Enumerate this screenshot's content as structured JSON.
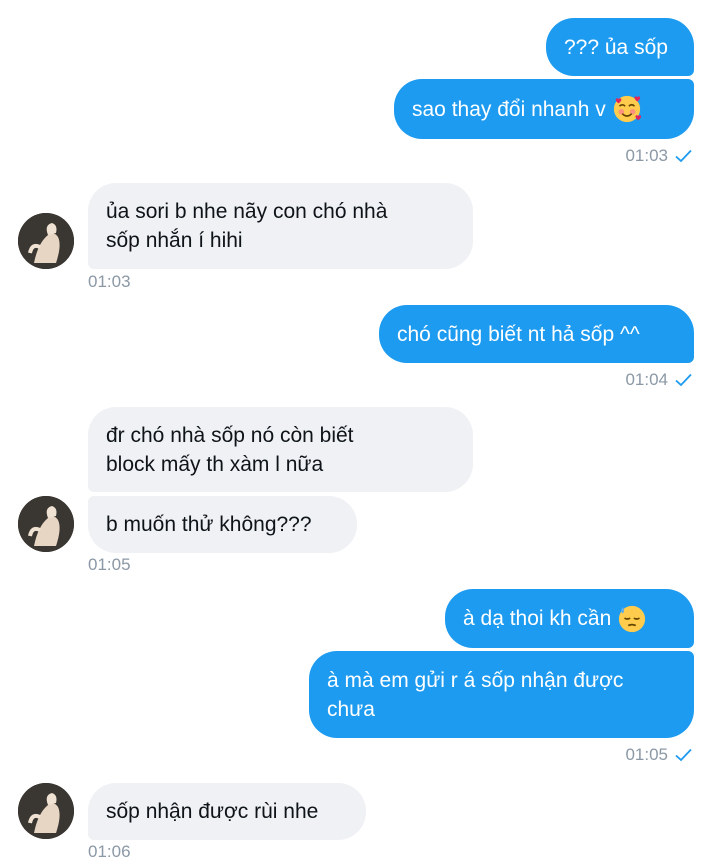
{
  "colors": {
    "outgoing_bubble": "#1d9bf0",
    "incoming_bubble": "#eff1f4",
    "timestamp": "#8b98a5",
    "read_check": "#1d9bf0"
  },
  "messages": {
    "m1": {
      "text": "??? ủa sốp"
    },
    "m2": {
      "text": "sao thay đổi nhanh v",
      "emoji": "smiling-face-with-hearts-icon"
    },
    "t1": {
      "time": "01:03"
    },
    "m3": {
      "line1": "ủa sori b nhe nãy con chó nhà",
      "line2": "sốp nhắn í hihi"
    },
    "t2": {
      "time": "01:03"
    },
    "m4": {
      "text": "chó cũng biết nt hả sốp ^^"
    },
    "t3": {
      "time": "01:04"
    },
    "m5": {
      "line1": "đr chó nhà sốp nó còn biết",
      "line2": "block mấy th xàm l nữa"
    },
    "m6": {
      "text": "b muốn thử không???"
    },
    "t4": {
      "time": "01:05"
    },
    "m7": {
      "text": "à dạ thoi kh cần",
      "emoji": "downcast-sweat-face-icon"
    },
    "m8": {
      "line1": "à mà em gửi r á sốp nhận được",
      "line2": "chưa"
    },
    "t5": {
      "time": "01:05"
    },
    "m9": {
      "text": "sốp nhận được rùi nhe"
    },
    "t6": {
      "time": "01:06"
    }
  }
}
